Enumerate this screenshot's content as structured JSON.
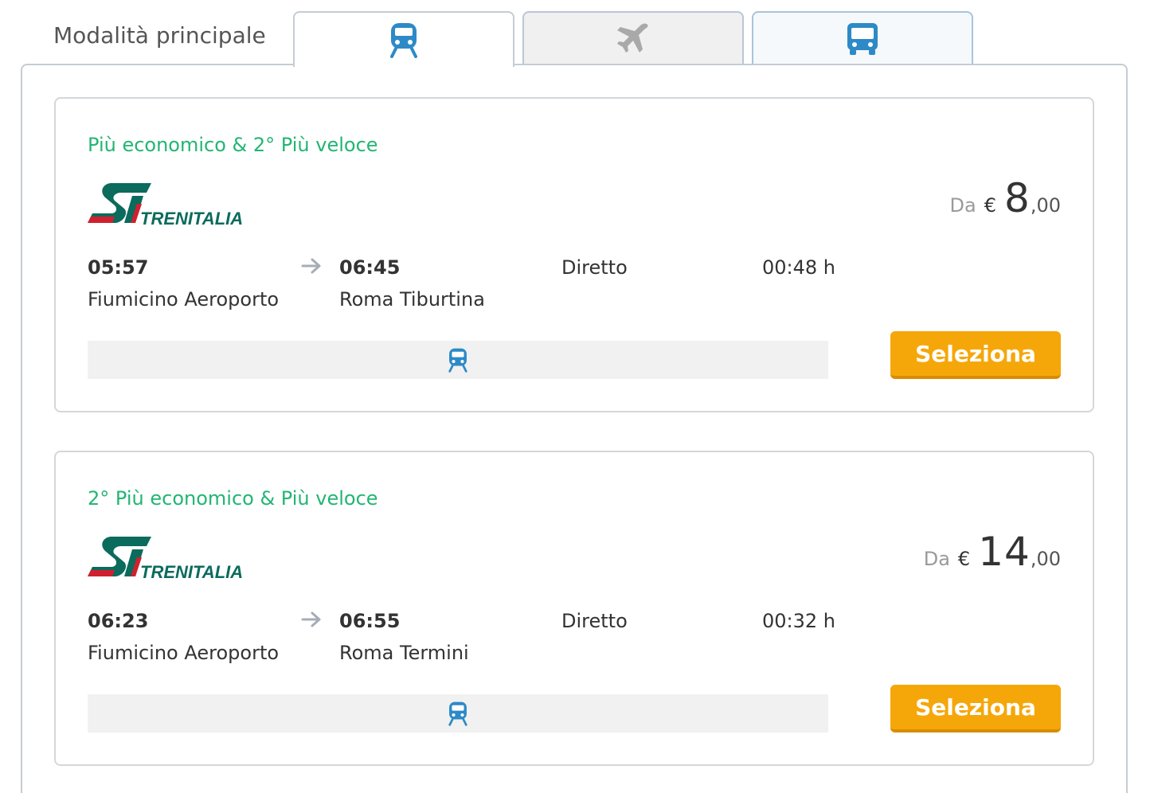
{
  "tabs": {
    "mode_label": "Modalità principale",
    "items": [
      {
        "icon": "train-icon",
        "active": true
      },
      {
        "icon": "plane-icon",
        "active": false
      },
      {
        "icon": "bus-icon",
        "active": false
      }
    ]
  },
  "colors": {
    "accent_green": "#22b573",
    "icon_blue": "#2d8ac7",
    "button_orange": "#f5a70a",
    "trenitalia_green": "#0b6b5d",
    "trenitalia_red": "#d0202f"
  },
  "results": [
    {
      "tag": "Più economico & 2° Più veloce",
      "operator": "TRENITALIA",
      "price": {
        "prefix": "Da",
        "currency": "€",
        "integer": "8",
        "decimals": ",00"
      },
      "departure_time": "05:57",
      "arrival_time": "06:45",
      "type": "Diretto",
      "duration": "00:48 h",
      "departure_station": "Fiumicino Aeroporto",
      "arrival_station": "Roma Tiburtina",
      "button": "Seleziona"
    },
    {
      "tag": "2° Più economico & Più veloce",
      "operator": "TRENITALIA",
      "price": {
        "prefix": "Da",
        "currency": "€",
        "integer": "14",
        "decimals": ",00"
      },
      "departure_time": "06:23",
      "arrival_time": "06:55",
      "type": "Diretto",
      "duration": "00:32 h",
      "departure_station": "Fiumicino Aeroporto",
      "arrival_station": "Roma Termini",
      "button": "Seleziona"
    }
  ]
}
